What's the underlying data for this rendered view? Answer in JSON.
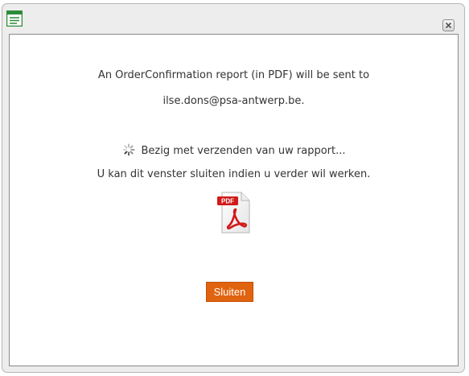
{
  "dialog": {
    "close_icon": "close-icon",
    "app_icon": "report-window-icon"
  },
  "message": {
    "line1": "An OrderConfirmation report (in PDF) will be sent to",
    "line2": "ilse.dons@psa-antwerp.be.",
    "status": "Bezig met verzenden van uw rapport...",
    "hint": "U kan dit venster sluiten indien u verder wil werken."
  },
  "pdf": {
    "badge": "PDF",
    "icon": "pdf-file-icon"
  },
  "actions": {
    "close_label": "Sluiten"
  },
  "colors": {
    "button_bg": "#e0630f",
    "app_icon_green": "#2e8b3a",
    "pdf_red": "#d11a1a"
  }
}
